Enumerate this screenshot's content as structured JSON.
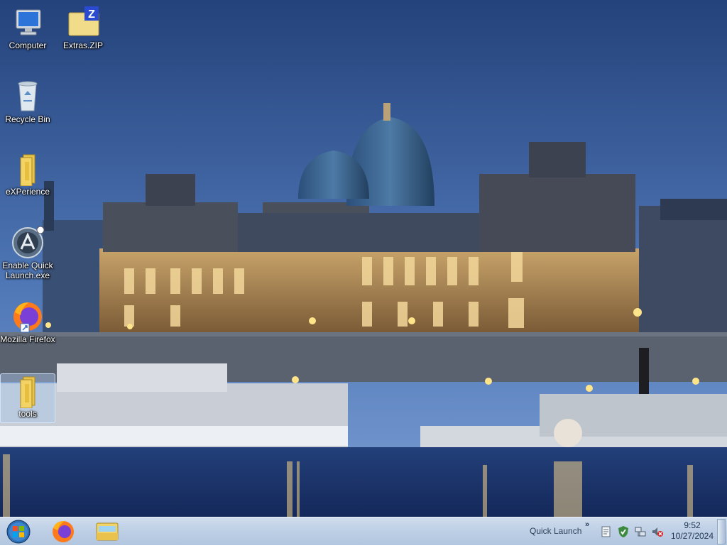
{
  "desktop": {
    "icons": [
      {
        "id": "computer",
        "label": "Computer",
        "icon": "computer-icon"
      },
      {
        "id": "extras-zip",
        "label": "Extras.ZIP",
        "icon": "zip-folder-icon"
      },
      {
        "id": "recycle-bin",
        "label": "Recycle Bin",
        "icon": "recycle-bin-icon"
      },
      {
        "id": "experience",
        "label": "eXPerience",
        "icon": "folder-icon"
      },
      {
        "id": "enable-quick-launch",
        "label": "Enable Quick Launch.exe",
        "icon": "quick-launch-app-icon"
      },
      {
        "id": "mozilla-firefox",
        "label": "Mozilla Firefox",
        "icon": "firefox-icon"
      },
      {
        "id": "tools",
        "label": "tools",
        "icon": "folder-icon",
        "selected": true
      }
    ]
  },
  "taskbar": {
    "start_icon": "windows-start-orb-icon",
    "pinned": [
      {
        "id": "firefox",
        "icon": "firefox-icon"
      },
      {
        "id": "explorer",
        "icon": "file-explorer-icon"
      }
    ],
    "quick_launch_label": "Quick Launch",
    "quick_launch_chevron": "»",
    "tray_icons": [
      "action-center-icon",
      "security-shield-icon",
      "network-icon",
      "volume-muted-icon"
    ],
    "clock": {
      "time": "9:52",
      "date": "10/27/2024"
    }
  },
  "colors": {
    "sky_top": "#26457f",
    "sky_bottom": "#5e86c2",
    "taskbar": "#bfd0e6"
  }
}
